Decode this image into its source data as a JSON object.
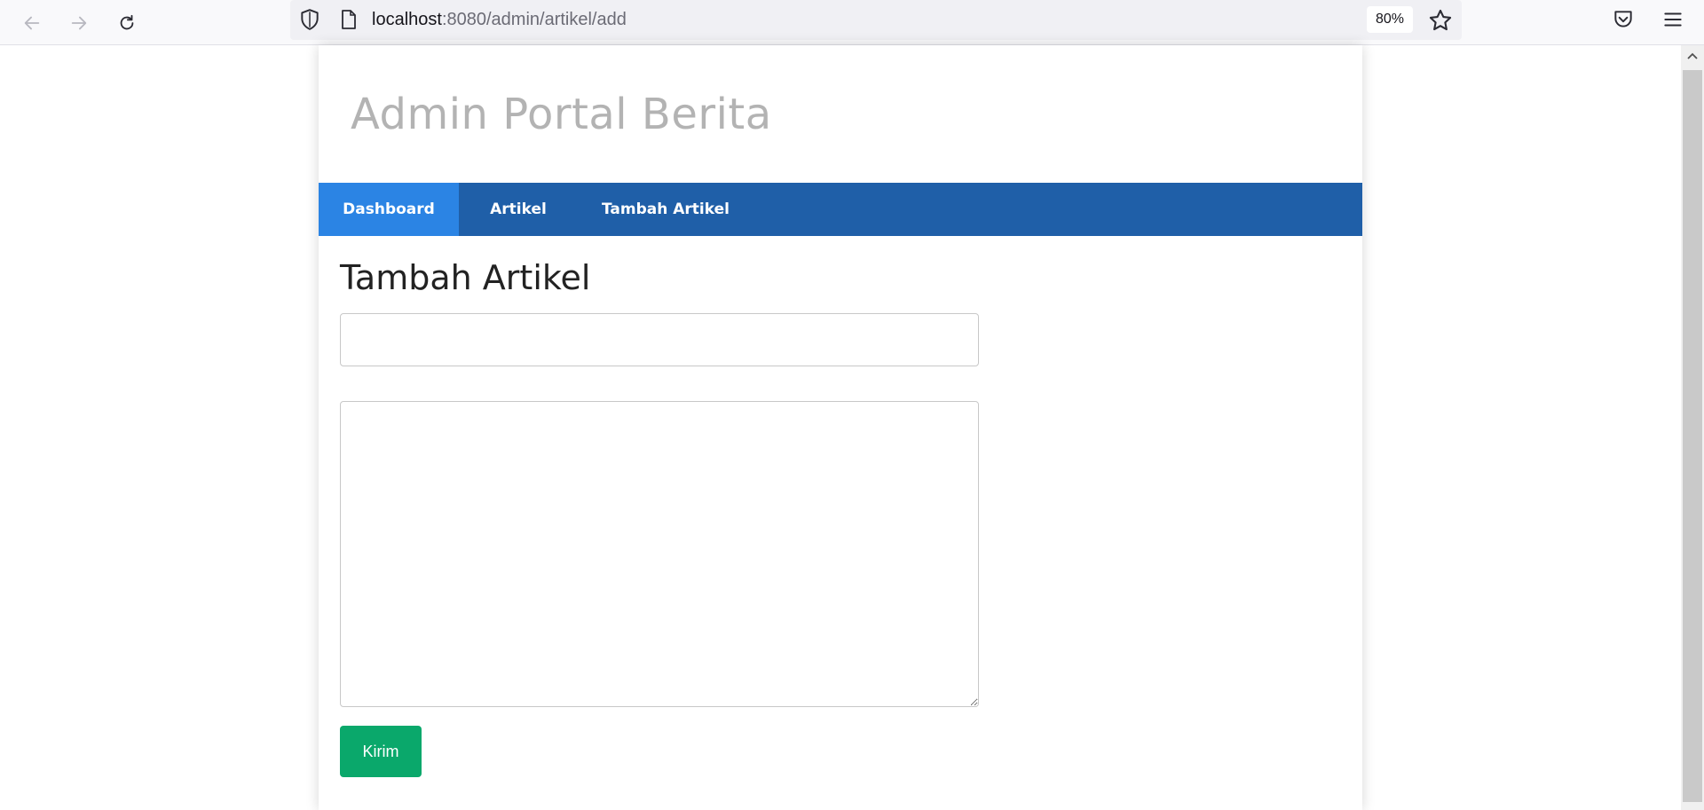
{
  "browser": {
    "url_host": "localhost",
    "url_rest": ":8080/admin/artikel/add",
    "zoom": "80%"
  },
  "site": {
    "title": "Admin Portal Berita",
    "nav": [
      {
        "label": "Dashboard",
        "active": true
      },
      {
        "label": "Artikel",
        "active": false
      },
      {
        "label": "Tambah Artikel",
        "active": false
      }
    ]
  },
  "form": {
    "heading": "Tambah Artikel",
    "title_value": "",
    "content_value": "",
    "submit_label": "Kirim"
  },
  "colors": {
    "nav_bg": "#1f5fa8",
    "nav_active": "#2b84e4",
    "submit": "#0aa86b",
    "site_title": "#b3b3b3"
  }
}
